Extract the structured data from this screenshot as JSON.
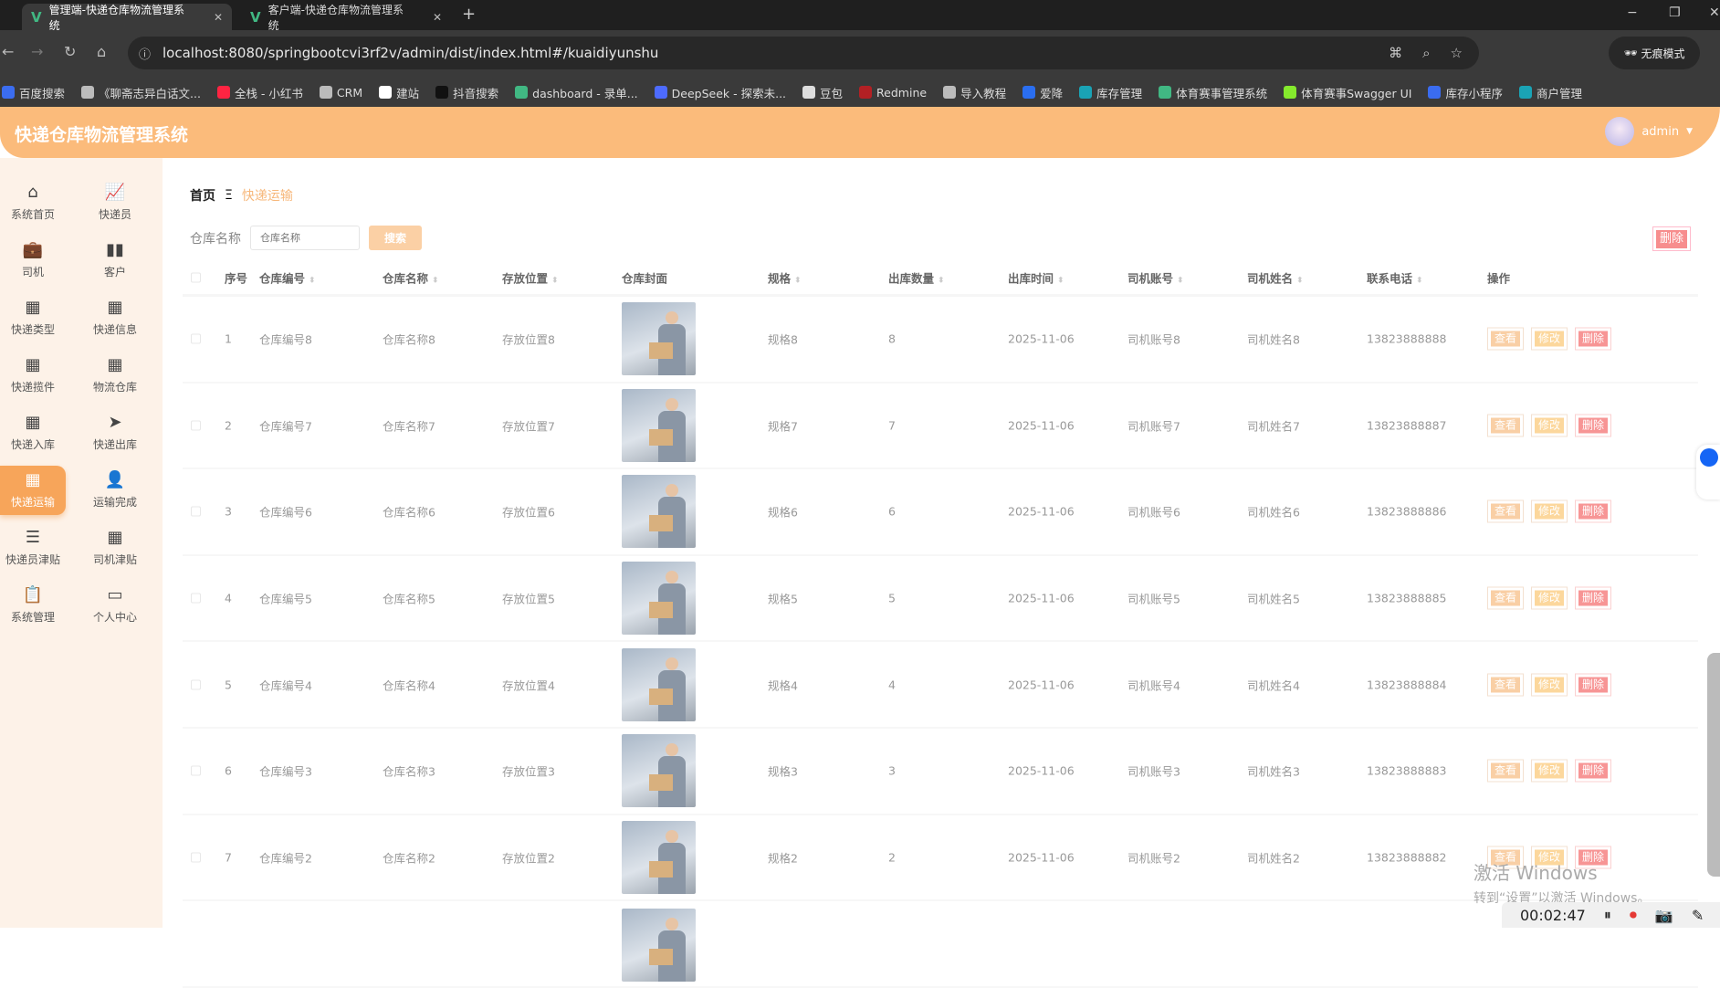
{
  "browser": {
    "tabs": [
      {
        "label": "管理端-快递仓库物流管理系统",
        "active": true
      },
      {
        "label": "客户端-快递仓库物流管理系统",
        "active": false
      }
    ],
    "url": "localhost:8080/springbootcvi3rf2v/admin/dist/index.html#/kuaidiyunshu",
    "incognito_label": "无痕模式",
    "bookmarks": [
      {
        "label": "百度搜索",
        "color": "#3b6df0"
      },
      {
        "label": "《聊斋志异白话文...",
        "color": "#bbbbbb"
      },
      {
        "label": "全栈 - 小红书",
        "color": "#ff2442"
      },
      {
        "label": "CRM",
        "color": "#bbbbbb"
      },
      {
        "label": "建站",
        "color": "#ffffff"
      },
      {
        "label": "抖音搜索",
        "color": "#111111"
      },
      {
        "label": "dashboard - 录单...",
        "color": "#41b883"
      },
      {
        "label": "DeepSeek - 探索未...",
        "color": "#4d6bfe"
      },
      {
        "label": "豆包",
        "color": "#dddddd"
      },
      {
        "label": "Redmine",
        "color": "#b32024"
      },
      {
        "label": "导入教程",
        "color": "#bbbbbb"
      },
      {
        "label": "爱降",
        "color": "#2a6ef0"
      },
      {
        "label": "库存管理",
        "color": "#1aa3b5"
      },
      {
        "label": "体育赛事管理系统",
        "color": "#41b883"
      },
      {
        "label": "体育赛事Swagger UI",
        "color": "#85ea2d"
      },
      {
        "label": "库存小程序",
        "color": "#3a6cf0"
      },
      {
        "label": "商户管理",
        "color": "#1aa3b5"
      }
    ]
  },
  "header": {
    "title": "快递仓库物流管理系统",
    "user": "admin"
  },
  "sidebar": {
    "items": [
      {
        "label": "系统首页",
        "icon": "⌂"
      },
      {
        "label": "快递员",
        "icon": "📈"
      },
      {
        "label": "司机",
        "icon": "💼"
      },
      {
        "label": "客户",
        "icon": "▮▮"
      },
      {
        "label": "快递类型",
        "icon": "▦"
      },
      {
        "label": "快递信息",
        "icon": "▦"
      },
      {
        "label": "快递揽件",
        "icon": "▦"
      },
      {
        "label": "物流仓库",
        "icon": "▦"
      },
      {
        "label": "快递入库",
        "icon": "▦"
      },
      {
        "label": "快递出库",
        "icon": "➤"
      },
      {
        "label": "快递运输",
        "icon": "▦",
        "active": true
      },
      {
        "label": "运输完成",
        "icon": "👤"
      },
      {
        "label": "快递员津贴",
        "icon": "☰"
      },
      {
        "label": "司机津贴",
        "icon": "▦"
      },
      {
        "label": "系统管理",
        "icon": "📋"
      },
      {
        "label": "个人中心",
        "icon": "▭"
      }
    ]
  },
  "breadcrumb": {
    "home": "首页",
    "sep": "Ξ",
    "current": "快递运输"
  },
  "search": {
    "label": "仓库名称",
    "placeholder": "仓库名称",
    "button": "搜索",
    "bulk_delete": "删除"
  },
  "table": {
    "headers": {
      "index": "序号",
      "code": "仓库编号",
      "name": "仓库名称",
      "location": "存放位置",
      "cover": "仓库封面",
      "spec": "规格",
      "qty": "出库数量",
      "time": "出库时间",
      "driver_acct": "司机账号",
      "driver_name": "司机姓名",
      "phone": "联系电话",
      "ops": "操作"
    },
    "actions": {
      "view": "查看",
      "edit": "修改",
      "delete": "删除"
    },
    "rows": [
      {
        "index": "1",
        "code": "仓库编号8",
        "name": "仓库名称8",
        "location": "存放位置8",
        "spec": "规格8",
        "qty": "8",
        "time": "2025-11-06",
        "driver_acct": "司机账号8",
        "driver_name": "司机姓名8",
        "phone": "13823888888"
      },
      {
        "index": "2",
        "code": "仓库编号7",
        "name": "仓库名称7",
        "location": "存放位置7",
        "spec": "规格7",
        "qty": "7",
        "time": "2025-11-06",
        "driver_acct": "司机账号7",
        "driver_name": "司机姓名7",
        "phone": "13823888887"
      },
      {
        "index": "3",
        "code": "仓库编号6",
        "name": "仓库名称6",
        "location": "存放位置6",
        "spec": "规格6",
        "qty": "6",
        "time": "2025-11-06",
        "driver_acct": "司机账号6",
        "driver_name": "司机姓名6",
        "phone": "13823888886"
      },
      {
        "index": "4",
        "code": "仓库编号5",
        "name": "仓库名称5",
        "location": "存放位置5",
        "spec": "规格5",
        "qty": "5",
        "time": "2025-11-06",
        "driver_acct": "司机账号5",
        "driver_name": "司机姓名5",
        "phone": "13823888885"
      },
      {
        "index": "5",
        "code": "仓库编号4",
        "name": "仓库名称4",
        "location": "存放位置4",
        "spec": "规格4",
        "qty": "4",
        "time": "2025-11-06",
        "driver_acct": "司机账号4",
        "driver_name": "司机姓名4",
        "phone": "13823888884"
      },
      {
        "index": "6",
        "code": "仓库编号3",
        "name": "仓库名称3",
        "location": "存放位置3",
        "spec": "规格3",
        "qty": "3",
        "time": "2025-11-06",
        "driver_acct": "司机账号3",
        "driver_name": "司机姓名3",
        "phone": "13823888883"
      },
      {
        "index": "7",
        "code": "仓库编号2",
        "name": "仓库名称2",
        "location": "存放位置2",
        "spec": "规格2",
        "qty": "2",
        "time": "2025-11-06",
        "driver_acct": "司机账号2",
        "driver_name": "司机姓名2",
        "phone": "13823888882"
      }
    ]
  },
  "overlay": {
    "watermark_title": "激活 Windows",
    "watermark_sub": "转到“设置”以激活 Windows。",
    "recording_time": "00:02:47"
  }
}
